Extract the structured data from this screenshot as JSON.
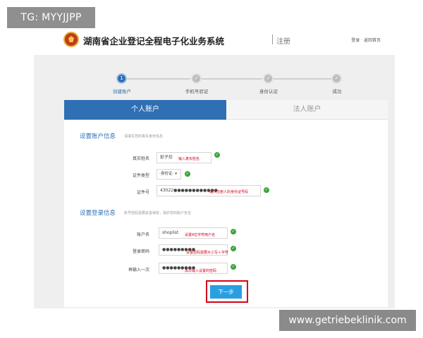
{
  "watermark_top": "TG: MYYJJPP",
  "watermark_bottom": "www.getriebeklinik.com",
  "header": {
    "title": "湖南省企业登记全程电子化业务系统",
    "subtitle": "注册",
    "links": "登录 · 返回首页"
  },
  "steps": [
    {
      "label": "创建账户",
      "icon": "1",
      "active": true
    },
    {
      "label": "手机号验证",
      "icon": "✓",
      "active": false
    },
    {
      "label": "身份认证",
      "icon": "✓",
      "active": false
    },
    {
      "label": "成功",
      "icon": "✓",
      "active": false
    }
  ],
  "tabs": {
    "personal": "个人账户",
    "legal": "法人账户"
  },
  "section_account": {
    "title": "设置账户信息",
    "desc": "请填写您的真实身份信息"
  },
  "section_login": {
    "title": "设置登录信息",
    "desc": "账号密码需要妥善保管，保护您的账户安全"
  },
  "fields": {
    "real_name": {
      "label": "真实姓名",
      "value": "彭子珍",
      "annotation": "输入真实姓名"
    },
    "id_type": {
      "label": "证件类型",
      "value": "-身份证- ▾"
    },
    "id_number": {
      "label": "证件号",
      "value": "43022●●●●●●●●●●●●",
      "annotation": "输入注册人的身份证号码"
    },
    "username": {
      "label": "账户名",
      "value": "shoplist",
      "annotation": "设置8位字符用户名"
    },
    "password": {
      "label": "登录密码",
      "value": "●●●●●●●●●",
      "annotation": "设置密码需要大小写＋字符"
    },
    "password_confirm": {
      "label": "再输入一次",
      "value": "●●●●●●●●●",
      "annotation": "再次输入设置的密码"
    }
  },
  "next_button": "下一步",
  "colors": {
    "primary": "#2f6fb3",
    "button": "#2a9fe0",
    "annotation": "#d0021b",
    "check": "#3aa53a"
  }
}
